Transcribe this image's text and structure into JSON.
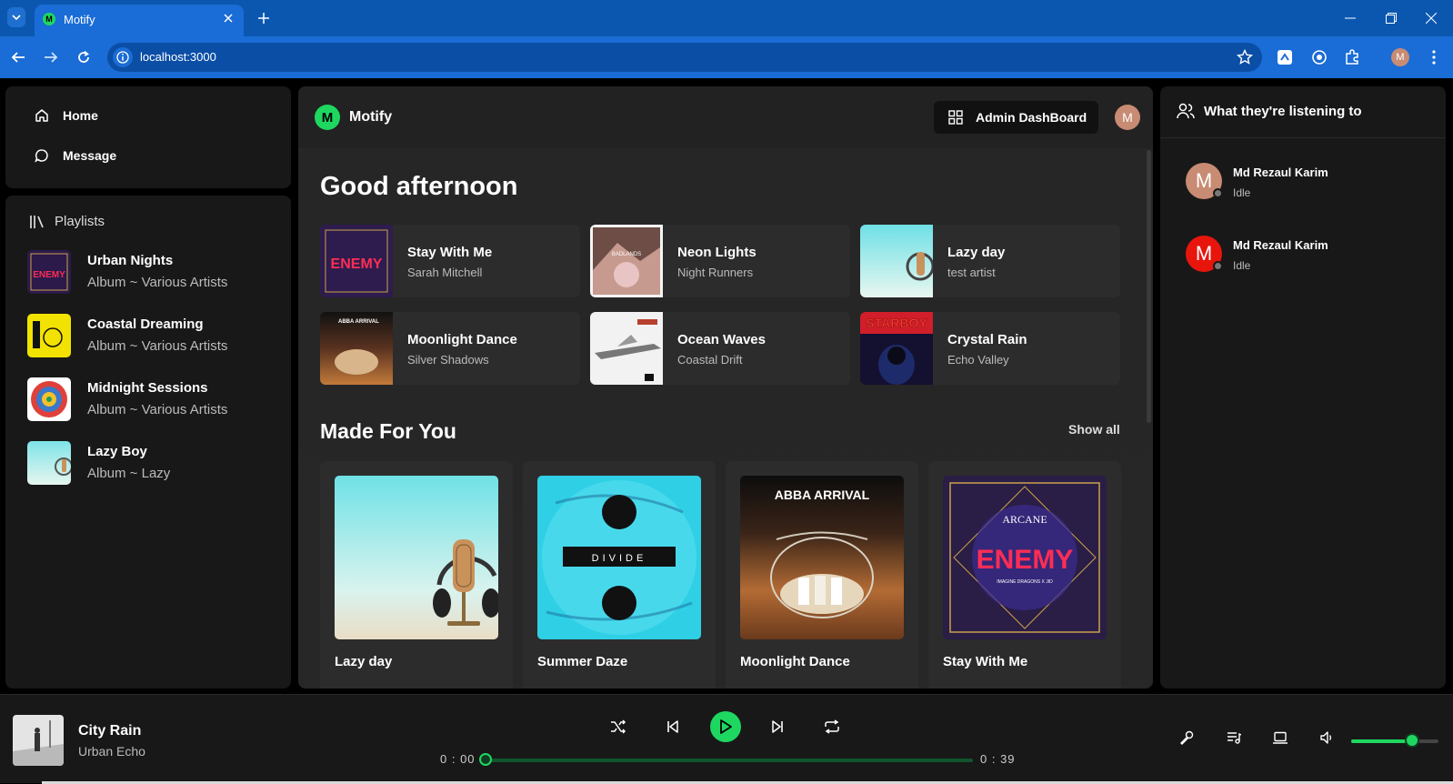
{
  "browser": {
    "tab_title": "Motify",
    "tab_favicon_letter": "M",
    "url": "localhost:3000",
    "profile_initial": "M",
    "accent": "#0b57b0"
  },
  "sidebar": {
    "nav": [
      {
        "label": "Home",
        "icon": "home-icon"
      },
      {
        "label": "Message",
        "icon": "message-icon"
      }
    ],
    "playlists_label": "Playlists",
    "playlists": [
      {
        "name": "Urban Nights",
        "subtitle": "Album ~ Various Artists"
      },
      {
        "name": "Coastal Dreaming",
        "subtitle": "Album ~ Various Artists"
      },
      {
        "name": "Midnight Sessions",
        "subtitle": "Album ~ Various Artists"
      },
      {
        "name": "Lazy Boy",
        "subtitle": "Album ~ Lazy"
      }
    ]
  },
  "header": {
    "logo_letter": "M",
    "app_name": "Motify",
    "admin_button": "Admin DashBoard",
    "user_initial": "M"
  },
  "main": {
    "greeting": "Good afternoon",
    "quick_picks": [
      {
        "title": "Stay With Me",
        "artist": "Sarah Mitchell",
        "cover_text": "ENEMY"
      },
      {
        "title": "Neon Lights",
        "artist": "Night Runners",
        "cover_text": "BADLANDS"
      },
      {
        "title": "Lazy day",
        "artist": "test artist",
        "cover_text": ""
      },
      {
        "title": "Moonlight Dance",
        "artist": "Silver Shadows",
        "cover_text": "ABBA ARRIVAL"
      },
      {
        "title": "Ocean Waves",
        "artist": "Coastal Drift",
        "cover_text": ""
      },
      {
        "title": "Crystal Rain",
        "artist": "Echo Valley",
        "cover_text": "STARBOY"
      }
    ],
    "made_for_you": {
      "title": "Made For You",
      "show_all": "Show all",
      "items": [
        {
          "title": "Lazy day",
          "cover_text": ""
        },
        {
          "title": "Summer Daze",
          "cover_text": "DIVIDE"
        },
        {
          "title": "Moonlight Dance",
          "cover_text": "ABBA ARRIVAL"
        },
        {
          "title": "Stay With Me",
          "cover_text": "ENEMY",
          "cover_top_text": "ARCANE",
          "cover_sub_text": "IMAGINE DRAGONS X JID"
        }
      ]
    }
  },
  "friends": {
    "title": "What they're listening to",
    "items": [
      {
        "name": "Md Rezaul Karim",
        "activity": "Idle",
        "initial": "M",
        "avatar_color": "#c88b73"
      },
      {
        "name": "Md Rezaul Karim",
        "activity": "Idle",
        "initial": "M",
        "avatar_color": "#e8150d"
      }
    ]
  },
  "player": {
    "title": "City Rain",
    "artist": "Urban Echo",
    "current_time": "0 : 00",
    "duration": "0 : 39",
    "progress": 0,
    "volume": 0.7,
    "accent": "#1ed760"
  }
}
